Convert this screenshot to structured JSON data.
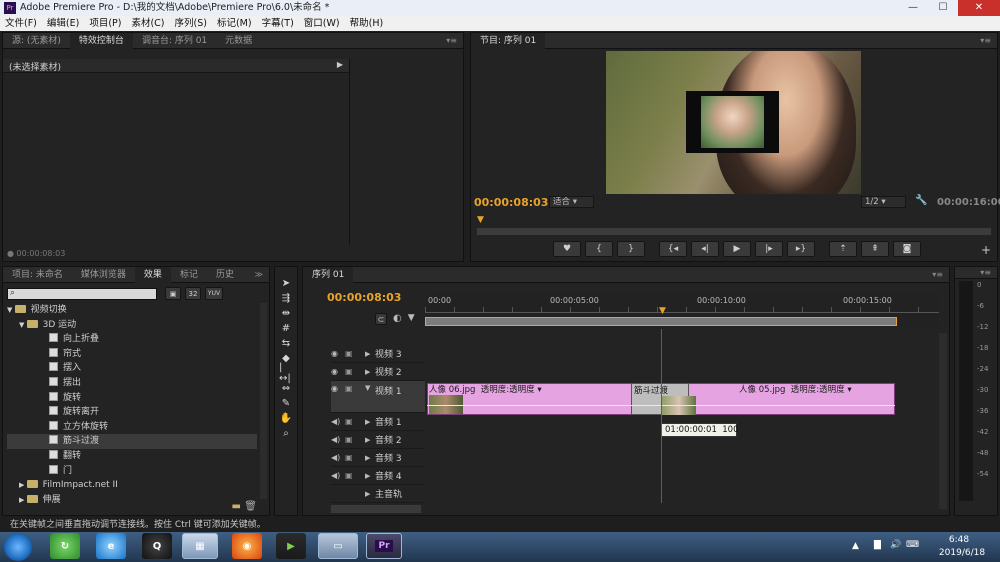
{
  "window": {
    "title": "Adobe Premiere Pro - D:\\我的文档\\Adobe\\Premiere Pro\\6.0\\未命名 *",
    "app_icon": "Pr"
  },
  "menu": [
    "文件(F)",
    "编辑(E)",
    "项目(P)",
    "素材(C)",
    "序列(S)",
    "标记(M)",
    "字幕(T)",
    "窗口(W)",
    "帮助(H)"
  ],
  "source_panel": {
    "tabs": [
      "源: (无素材)",
      "特效控制台",
      "调音台: 序列 01",
      "元数据"
    ],
    "active_tab": 1,
    "no_clip_label": "(未选择素材)",
    "timecode": "00:00:08:03"
  },
  "program_monitor": {
    "tab": "节目: 序列 01",
    "timecode": "00:00:08:03",
    "fit": "适合",
    "resolution": "1/2",
    "duration": "00:00:16:00",
    "controls": [
      "marker-icon",
      "in-point-icon",
      "out-point-icon",
      "go-to-in-icon",
      "step-back-icon",
      "play-icon",
      "step-forward-icon",
      "go-to-out-icon",
      "lift-icon",
      "extract-icon",
      "export-frame-icon"
    ]
  },
  "effects_panel": {
    "tabs": [
      "项目: 未命名",
      "媒体浏览器",
      "效果",
      "标记",
      "历史"
    ],
    "active_tab": 2,
    "badges": [
      "32",
      "YUV"
    ],
    "tree": [
      {
        "label": "视频切换",
        "level": 0,
        "kind": "folder",
        "open": true
      },
      {
        "label": "3D 运动",
        "level": 1,
        "kind": "folder",
        "open": true
      },
      {
        "label": "向上折叠",
        "level": 2,
        "kind": "effect"
      },
      {
        "label": "帘式",
        "level": 2,
        "kind": "effect"
      },
      {
        "label": "摆入",
        "level": 2,
        "kind": "effect"
      },
      {
        "label": "摆出",
        "level": 2,
        "kind": "effect"
      },
      {
        "label": "旋转",
        "level": 2,
        "kind": "effect"
      },
      {
        "label": "旋转离开",
        "level": 2,
        "kind": "effect"
      },
      {
        "label": "立方体旋转",
        "level": 2,
        "kind": "effect"
      },
      {
        "label": "筋斗过渡",
        "level": 2,
        "kind": "effect",
        "selected": true
      },
      {
        "label": "翻转",
        "level": 2,
        "kind": "effect"
      },
      {
        "label": "门",
        "level": 2,
        "kind": "effect"
      },
      {
        "label": "FilmImpact.net II",
        "level": 1,
        "kind": "folder",
        "open": false
      },
      {
        "label": "伸展",
        "level": 1,
        "kind": "folder",
        "open": false
      }
    ]
  },
  "timeline": {
    "tab": "序列 01",
    "timecode": "00:00:08:03",
    "ruler": [
      "00:00",
      "00:00:05:00",
      "00:00:10:00",
      "00:00:15:00"
    ],
    "tracks": [
      {
        "label": "视频 3",
        "type": "video"
      },
      {
        "label": "视频 2",
        "type": "video"
      },
      {
        "label": "视频 1",
        "type": "video",
        "expanded": true
      },
      {
        "label": "音频 1",
        "type": "audio"
      },
      {
        "label": "音频 2",
        "type": "audio"
      },
      {
        "label": "音频 3",
        "type": "audio"
      },
      {
        "label": "音频 4",
        "type": "audio"
      },
      {
        "label": "主音轨",
        "type": "master"
      }
    ],
    "clips": [
      {
        "name": "人像 06.jpg",
        "effect": "透明度:透明度"
      },
      {
        "name": "人像 05.jpg",
        "effect": "透明度:透明度"
      }
    ],
    "transition": "筋斗过渡",
    "tooltip_time": "01:00:00:01",
    "tooltip_value": "100"
  },
  "audio_meter": {
    "scale": [
      "0",
      "-6",
      "-12",
      "-18",
      "-24",
      "-30",
      "-36",
      "-42",
      "-48",
      "-54"
    ]
  },
  "status_bar": "在关键帧之间垂直拖动调节连接线。按住 Ctrl 键可添加关键帧。",
  "taskbar": {
    "time": "6:48",
    "date": "2019/6/18",
    "apps": [
      "360-icon",
      "ie-icon",
      "qq-icon",
      "explorer-icon",
      "firefox-icon",
      "media-player-icon",
      "folder-icon",
      "premiere-icon"
    ]
  },
  "colors": {
    "accent": "#e8a32a",
    "clip": "#e6a3e2",
    "playhead": "#d0302a"
  }
}
